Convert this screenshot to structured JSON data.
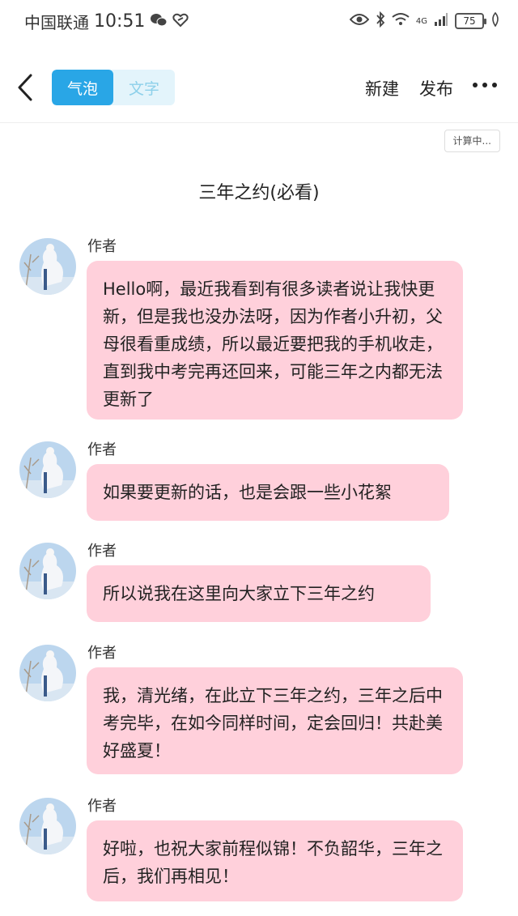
{
  "status_bar": {
    "carrier": "中国联通",
    "time": "10:51",
    "network": "4G",
    "battery": "75"
  },
  "toolbar": {
    "mode_tabs": [
      {
        "label": "气泡",
        "active": true
      },
      {
        "label": "文字",
        "active": false
      }
    ],
    "new_label": "新建",
    "publish_label": "发布",
    "calc_badge": "计算中..."
  },
  "document": {
    "title": "三年之约(必看)"
  },
  "messages": [
    {
      "author": "作者",
      "text": "Hello啊，最近我看到有很多读者说让我快更新，但是我也没办法呀，因为作者小升初，父母很看重成绩，所以最近要把我的手机收走，直到我中考完再还回来，可能三年之内都无法更新了"
    },
    {
      "author": "作者",
      "text": "如果要更新的话，也是会跟一些小花絮"
    },
    {
      "author": "作者",
      "text": "所以说我在这里向大家立下三年之约"
    },
    {
      "author": "作者",
      "text": "我，清光绪，在此立下三年之约，三年之后中考完毕，在如今同样时间，定会回归！共赴美好盛夏！"
    },
    {
      "author": "作者",
      "text": "好啦，也祝大家前程似锦！不负韶华，三年之后，我们再相见！"
    }
  ],
  "colors": {
    "accent": "#29a6e6",
    "bubble": "#ffd0db"
  }
}
